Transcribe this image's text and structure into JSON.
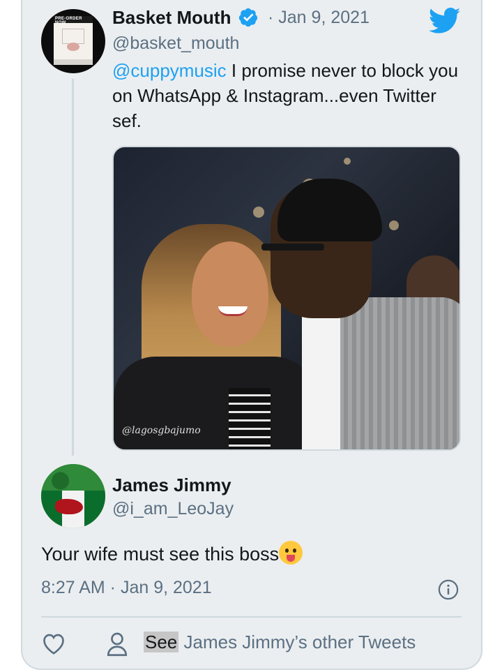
{
  "quoted_tweet": {
    "author_name": "Basket Mouth",
    "verified": true,
    "date": "Jan 9, 2021",
    "handle": "@basket_mouth",
    "mention": "@cuppymusic",
    "text": " I promise never to block you on WhatsApp & Instagram...even Twitter sef.",
    "avatar_cover_text": "PRE-ORDER NOW",
    "photo_watermark": "@lagosgbajumo"
  },
  "reply_tweet": {
    "author_name": "James Jimmy",
    "handle": "@i_am_LeoJay",
    "text": "Your wife must see this boss",
    "emoji": "tongue-out-emoji",
    "timestamp": "8:27 AM · Jan 9, 2021"
  },
  "actions": {
    "see_label": "See",
    "other_tweets_label": " James Jimmy’s other Tweets"
  },
  "icons": {
    "brand": "twitter-bird-icon",
    "verified": "verified-badge-icon",
    "info": "info-icon",
    "like": "heart-icon",
    "user": "person-icon"
  },
  "colors": {
    "accent": "#1da1f2",
    "card_bg": "#ebeef0",
    "muted_text": "#5b7083"
  }
}
